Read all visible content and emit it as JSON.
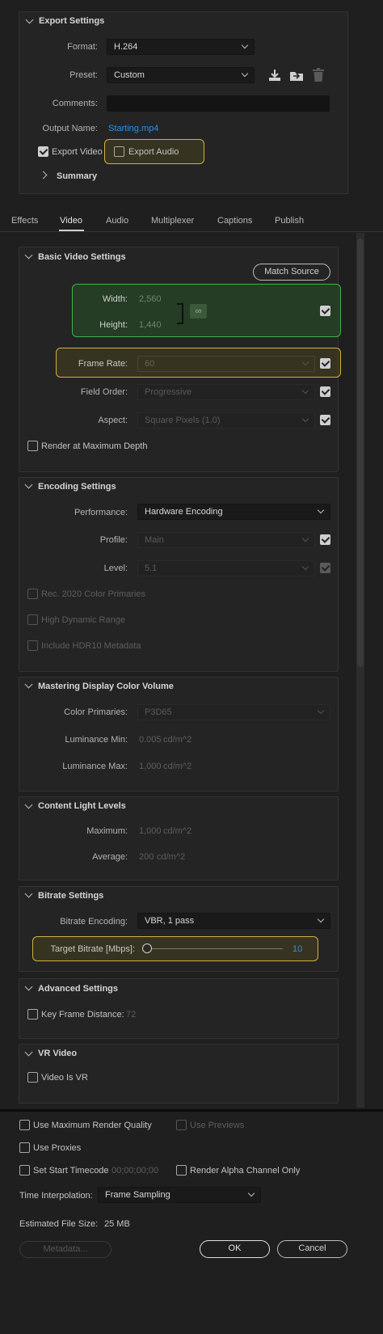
{
  "export_settings": {
    "title": "Export Settings",
    "format_label": "Format:",
    "format_value": "H.264",
    "preset_label": "Preset:",
    "preset_value": "Custom",
    "comments_label": "Comments:",
    "comments_value": "",
    "output_name_label": "Output Name:",
    "output_name_value": "Starting.mp4",
    "export_video_label": "Export Video",
    "export_video_checked": true,
    "export_audio_label": "Export Audio",
    "export_audio_checked": false,
    "summary_label": "Summary"
  },
  "tabs": [
    {
      "label": "Effects",
      "active": false
    },
    {
      "label": "Video",
      "active": true
    },
    {
      "label": "Audio",
      "active": false
    },
    {
      "label": "Multiplexer",
      "active": false
    },
    {
      "label": "Captions",
      "active": false
    },
    {
      "label": "Publish",
      "active": false
    }
  ],
  "basic_video": {
    "title": "Basic Video Settings",
    "match_source_label": "Match Source",
    "width_label": "Width:",
    "width_value": "2,560",
    "height_label": "Height:",
    "height_value": "1,440",
    "frame_rate_label": "Frame Rate:",
    "frame_rate_value": "60",
    "field_order_label": "Field Order:",
    "field_order_value": "Progressive",
    "aspect_label": "Aspect:",
    "aspect_value": "Square Pixels (1.0)",
    "render_max_depth_label": "Render at Maximum Depth"
  },
  "encoding": {
    "title": "Encoding Settings",
    "performance_label": "Performance:",
    "performance_value": "Hardware Encoding",
    "profile_label": "Profile:",
    "profile_value": "Main",
    "level_label": "Level:",
    "level_value": "5.1",
    "rec2020_label": "Rec. 2020 Color Primaries",
    "hdr_label": "High Dynamic Range",
    "hdr10_label": "Include HDR10 Metadata"
  },
  "mastering": {
    "title": "Mastering Display Color Volume",
    "primaries_label": "Color Primaries:",
    "primaries_value": "P3D65",
    "lum_min_label": "Luminance Min:",
    "lum_min_value": "0.005",
    "lum_max_label": "Luminance Max:",
    "lum_max_value": "1,000",
    "unit": "cd/m^2"
  },
  "content_light": {
    "title": "Content Light Levels",
    "max_label": "Maximum:",
    "max_value": "1,000",
    "avg_label": "Average:",
    "avg_value": "200",
    "unit": "cd/m^2"
  },
  "bitrate": {
    "title": "Bitrate Settings",
    "encoding_label": "Bitrate Encoding:",
    "encoding_value": "VBR, 1 pass",
    "target_label": "Target Bitrate [Mbps]:",
    "target_value": "10"
  },
  "advanced": {
    "title": "Advanced Settings",
    "keyframe_label": "Key Frame Distance:",
    "keyframe_value": "72"
  },
  "vr": {
    "title": "VR Video",
    "is_vr_label": "Video Is VR"
  },
  "bottom": {
    "max_render_label": "Use Maximum Render Quality",
    "use_previews_label": "Use Previews",
    "use_proxies_label": "Use Proxies",
    "start_timecode_label": "Set Start Timecode",
    "start_timecode_value": "00;00;00;00",
    "alpha_only_label": "Render Alpha Channel Only",
    "time_interp_label": "Time Interpolation:",
    "time_interp_value": "Frame Sampling",
    "est_size_label": "Estimated File Size:",
    "est_size_value": "25 MB",
    "metadata_label": "Metadata...",
    "ok_label": "OK",
    "cancel_label": "Cancel"
  },
  "colors": {
    "highlight_yellow": "#d1b13a",
    "highlight_green": "#3bb54a",
    "link_blue": "#2f8fe0"
  }
}
